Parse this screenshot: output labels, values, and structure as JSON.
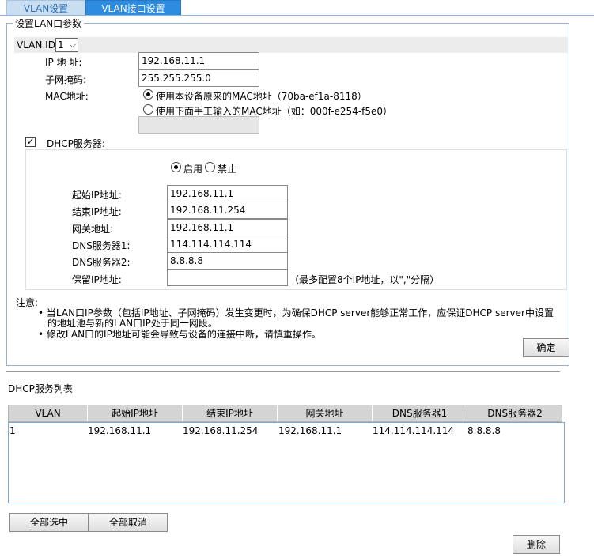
{
  "tabs": [
    {
      "label": "VLAN设置"
    },
    {
      "label": "VLAN接口设置"
    }
  ],
  "lan": {
    "legend": "设置LAN口参数",
    "vlan_id_label": "VLAN ID",
    "vlan_id_value": "1",
    "ip_label": "IP 地 址:",
    "ip_value": "192.168.11.1",
    "mask_label": "子网掩码:",
    "mask_value": "255.255.255.0",
    "mac_label": "MAC地址:",
    "mac_option1": "使用本设备原来的MAC地址（70ba-ef1a-8118）",
    "mac_option2": "使用下面手工输入的MAC地址（如：000f-e254-f5e0）",
    "mac_value": ""
  },
  "dhcp": {
    "label": "DHCP服务器:",
    "enable_label": "启用",
    "disable_label": "禁止",
    "start_label": "起始IP地址:",
    "start_value": "192.168.11.1",
    "end_label": "结束IP地址:",
    "end_value": "192.168.11.254",
    "gw_label": "网关地址:",
    "gw_value": "192.168.11.1",
    "dns1_label": "DNS服务器1:",
    "dns1_value": "114.114.114.114",
    "dns2_label": "DNS服务器2:",
    "dns2_value": "8.8.8.8",
    "reserve_label": "保留IP地址:",
    "reserve_value": "",
    "reserve_hint": "（最多配置8个IP地址，以\",\"分隔）"
  },
  "note": {
    "title": "注意:",
    "line1": "•  当LAN口IP参数（包括IP地址、子网掩码）发生变更时，为确保DHCP server能够正常工作，应保证DHCP server中设置",
    "line1b": "的地址池与新的LAN口IP处于同一网段。",
    "line2": "•  修改LAN口的IP地址可能会导致与设备的连接中断，请慎重操作。"
  },
  "confirm_label": "确定",
  "list": {
    "title": "DHCP服务列表",
    "columns": [
      "VLAN",
      "起始IP地址",
      "结束IP地址",
      "网关地址",
      "DNS服务器1",
      "DNS服务器2"
    ],
    "rows": [
      [
        "1",
        "192.168.11.1",
        "192.168.11.254",
        "192.168.11.1",
        "114.114.114.114",
        "8.8.8.8"
      ]
    ]
  },
  "select_all_label": "全部选中",
  "cancel_all_label": "全部取消",
  "delete_label": "删除"
}
